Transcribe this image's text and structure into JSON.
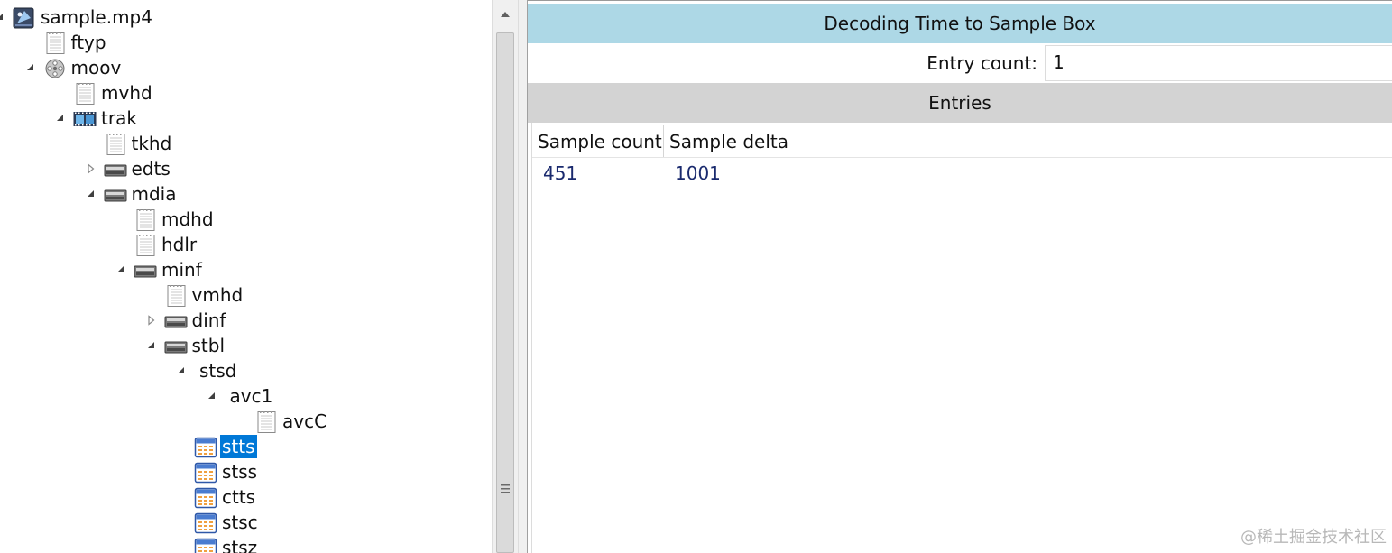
{
  "tree": {
    "nodes": [
      {
        "label": "sample.mp4",
        "depth": 0,
        "toggle": "expanded",
        "icon": "video-file-icon",
        "selected": false
      },
      {
        "label": "ftyp",
        "depth": 1,
        "toggle": "none",
        "icon": "document-icon",
        "selected": false
      },
      {
        "label": "moov",
        "depth": 1,
        "toggle": "expanded",
        "icon": "movie-reel-icon",
        "selected": false
      },
      {
        "label": "mvhd",
        "depth": 2,
        "toggle": "none",
        "icon": "document-icon",
        "selected": false
      },
      {
        "label": "trak",
        "depth": 2,
        "toggle": "expanded",
        "icon": "film-strip-icon",
        "selected": false
      },
      {
        "label": "tkhd",
        "depth": 3,
        "toggle": "none",
        "icon": "document-icon",
        "selected": false
      },
      {
        "label": "edts",
        "depth": 3,
        "toggle": "collapsed",
        "icon": "container-box-icon",
        "selected": false
      },
      {
        "label": "mdia",
        "depth": 3,
        "toggle": "expanded",
        "icon": "container-box-icon",
        "selected": false
      },
      {
        "label": "mdhd",
        "depth": 4,
        "toggle": "none",
        "icon": "document-icon",
        "selected": false
      },
      {
        "label": "hdlr",
        "depth": 4,
        "toggle": "none",
        "icon": "document-icon",
        "selected": false
      },
      {
        "label": "minf",
        "depth": 4,
        "toggle": "expanded",
        "icon": "container-box-icon",
        "selected": false
      },
      {
        "label": "vmhd",
        "depth": 5,
        "toggle": "none",
        "icon": "document-icon",
        "selected": false
      },
      {
        "label": "dinf",
        "depth": 5,
        "toggle": "collapsed",
        "icon": "container-box-icon",
        "selected": false
      },
      {
        "label": "stbl",
        "depth": 5,
        "toggle": "expanded",
        "icon": "container-box-icon",
        "selected": false
      },
      {
        "label": "stsd",
        "depth": 6,
        "toggle": "expanded",
        "icon": "none",
        "selected": false
      },
      {
        "label": "avc1",
        "depth": 7,
        "toggle": "expanded",
        "icon": "none",
        "selected": false
      },
      {
        "label": "avcC",
        "depth": 8,
        "toggle": "none",
        "icon": "document-icon",
        "selected": false
      },
      {
        "label": "stts",
        "depth": 6,
        "toggle": "none",
        "icon": "table-icon",
        "selected": true
      },
      {
        "label": "stss",
        "depth": 6,
        "toggle": "none",
        "icon": "table-icon",
        "selected": false
      },
      {
        "label": "ctts",
        "depth": 6,
        "toggle": "none",
        "icon": "table-icon",
        "selected": false
      },
      {
        "label": "stsc",
        "depth": 6,
        "toggle": "none",
        "icon": "table-icon",
        "selected": false
      },
      {
        "label": "stsz",
        "depth": 6,
        "toggle": "none",
        "icon": "table-icon",
        "selected": false
      }
    ]
  },
  "detail": {
    "title": "Decoding Time to Sample Box",
    "entry_count_label": "Entry count:",
    "entry_count_value": "1",
    "entries_header": "Entries",
    "columns": [
      "Sample count",
      "Sample delta"
    ],
    "rows": [
      [
        "451",
        "1001"
      ]
    ]
  },
  "colors": {
    "title_bar": "#add8e6",
    "section_header": "#d3d3d3",
    "selection": "#0078d7",
    "cell_text": "#1a2a6e"
  },
  "watermark": "@稀土掘金技术社区"
}
